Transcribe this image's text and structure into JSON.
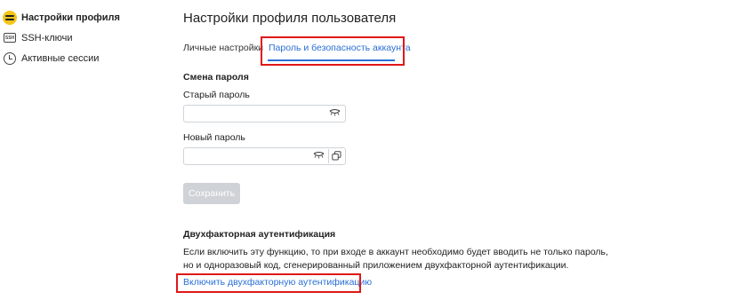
{
  "sidebar": {
    "items": [
      {
        "label": "Настройки профиля",
        "icon": "profile-settings-icon"
      },
      {
        "label": "SSH-ключи",
        "icon": "ssh-key-icon",
        "icon_text": "SSH"
      },
      {
        "label": "Активные сессии",
        "icon": "clock-icon"
      }
    ]
  },
  "main": {
    "title": "Настройки профиля пользователя",
    "tabs": [
      {
        "label": "Личные настройки"
      },
      {
        "label": "Пароль и безопасность аккаунта",
        "active": true
      }
    ],
    "password_section": {
      "title": "Смена пароля",
      "old_password_label": "Старый пароль",
      "new_password_label": "Новый пароль",
      "save_label": "Сохранить"
    },
    "tfa_section": {
      "title": "Двухфакторная аутентификация",
      "description_line1": "Если включить эту функцию, то при входе в аккаунт необходимо будет вводить не только пароль,",
      "description_line2": "но и одноразовый код, сгенерированный приложением двухфакторной аутентификации.",
      "enable_link": "Включить двухфакторную аутентификацию"
    }
  },
  "colors": {
    "accent": "#2a6fd6",
    "highlight": "#e01818",
    "profile_icon": "#f5c518",
    "disabled_button": "#cfd2d6"
  }
}
